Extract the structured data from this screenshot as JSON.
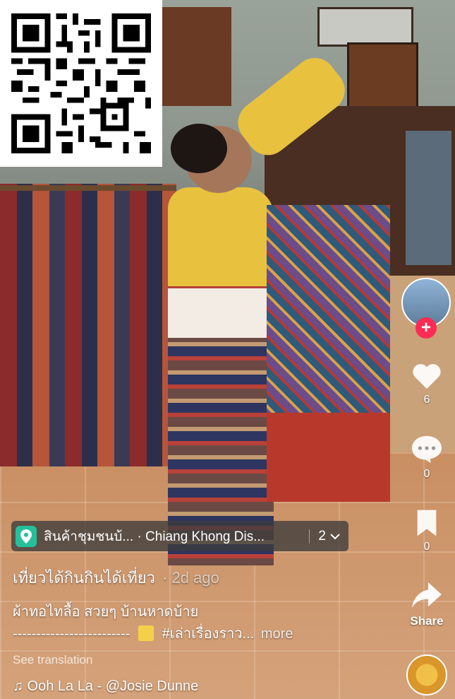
{
  "location": {
    "text": "สินค้าชุมชนบ้... · Chiang Khong Dis...",
    "count": "2"
  },
  "post": {
    "title": "เที่ยวได้กินกินได้เที่ยว",
    "age": "· 2d ago",
    "desc_line1": "ผ้าทอไทลื้อ สวยๆ บ้านหาดบ้าย",
    "desc_line2_dashes": "-------------------------",
    "desc_line2_tag": "#เล่าเรื่องราว...",
    "more": "more",
    "see_translation": "See translation",
    "music": "♫ Ooh La La - @Josie Dunne"
  },
  "actions": {
    "likes": "6",
    "comments": "0",
    "saves": "0",
    "share_label": "Share"
  },
  "icons": {
    "location": "location-pin-icon",
    "chevron": "chevron-down-icon",
    "like": "heart-icon",
    "comment": "comment-bubble-icon",
    "save": "bookmark-icon",
    "share": "share-arrow-icon",
    "follow": "plus-icon",
    "music_note": "music-note-icon",
    "qr": "qr-code"
  },
  "colors": {
    "follow": "#fe2c55",
    "location_pin": "#25c09a"
  }
}
